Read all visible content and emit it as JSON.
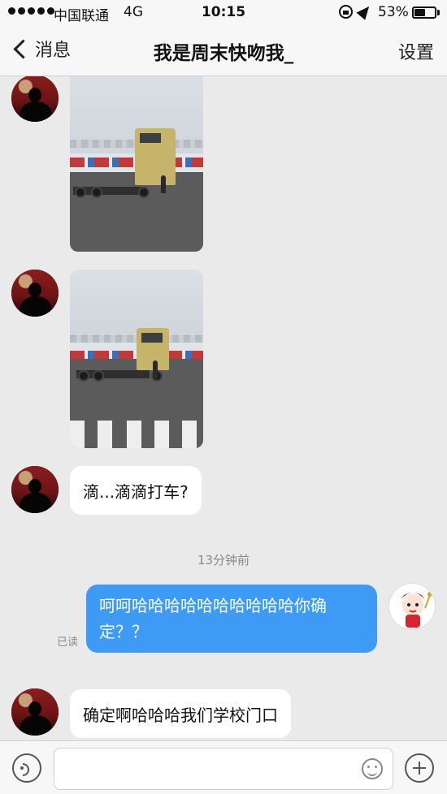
{
  "status_bar": {
    "carrier": "中国联通",
    "network": "4G",
    "time": "10:15",
    "battery": "53%",
    "battery_level": 0.53
  },
  "nav": {
    "back_label": "消息",
    "title": "我是周末快吻我_",
    "settings_label": "设置"
  },
  "messages": [
    {
      "from": "other",
      "type": "image",
      "content": "truck photo"
    },
    {
      "from": "other",
      "type": "image",
      "content": "truck photo"
    },
    {
      "from": "other",
      "type": "text",
      "text": "滴...滴滴打车?"
    },
    {
      "from": "system",
      "type": "timestamp",
      "text": "13分钟前"
    },
    {
      "from": "me",
      "type": "text",
      "text": "呵呵哈哈哈哈哈哈哈哈哈哈你确定？？",
      "read_status": "已读"
    },
    {
      "from": "other",
      "type": "text",
      "text": "确定啊哈哈哈我们学校门口"
    }
  ],
  "input": {
    "placeholder": ""
  },
  "colors": {
    "my_bubble": "#3d9bf5",
    "background": "#eaeaea"
  },
  "icons": [
    "back-chevron-icon",
    "voice-icon",
    "emoji-icon",
    "plus-icon"
  ]
}
